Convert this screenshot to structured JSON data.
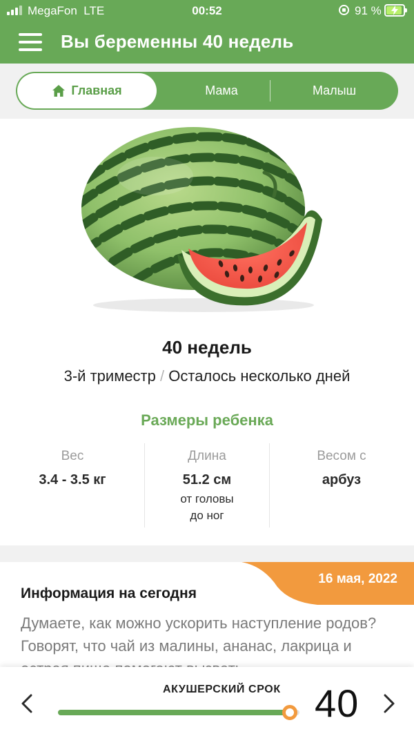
{
  "status_bar": {
    "carrier": "MegaFon",
    "network": "LTE",
    "time": "00:52",
    "battery_percent": "91 %",
    "battery_level": 0.91
  },
  "header": {
    "title": "Вы беременны 40 недель",
    "menu_icon": "hamburger-menu-icon",
    "color": "#68a957"
  },
  "tabs": [
    {
      "label": "Главная",
      "icon": "home-icon",
      "active": true
    },
    {
      "label": "Мама",
      "active": false
    },
    {
      "label": "Малыш",
      "active": false
    }
  ],
  "main": {
    "illustration": "watermelon",
    "week_title": "40 недель",
    "trimester": "3-й триместр",
    "separator": "/",
    "remaining": "Осталось несколько дней",
    "sizes_title": "Размеры ребенка",
    "stats": {
      "weight": {
        "label": "Вес",
        "value": "3.4 - 3.5 кг"
      },
      "length": {
        "label": "Длина",
        "value": "51.2 см",
        "note_line1": "от головы",
        "note_line2": "до ног"
      },
      "compare": {
        "label": "Весом с",
        "value": "арбуз"
      }
    }
  },
  "info_card": {
    "date": "16 мая, 2022",
    "title": "Информация на сегодня",
    "body": "Думаете, как можно ускорить наступление родов? Говорят, что чай из малины, ананас, лакрица и острая пища помогают вызвать",
    "date_tag_color": "#f29a3e"
  },
  "bottom_bar": {
    "label": "АКУШЕРСКИЙ СРОК",
    "week": "40",
    "progress": 0.96,
    "accent": "#f29a3e",
    "fill_color": "#68a957"
  }
}
